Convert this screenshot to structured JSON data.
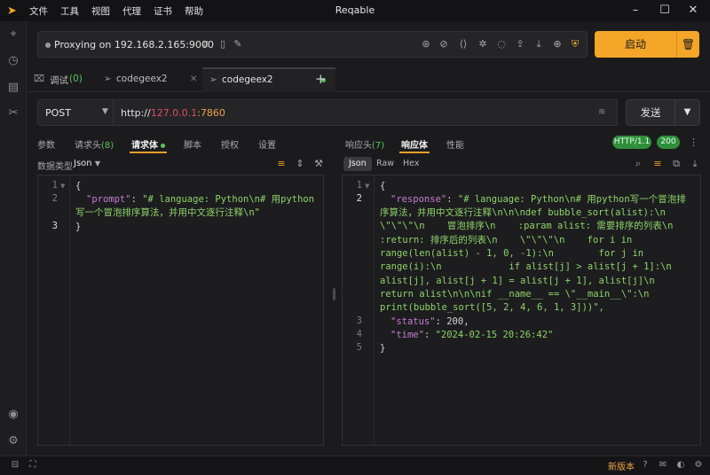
{
  "app": {
    "title": "Reqable"
  },
  "menu": [
    "文件",
    "工具",
    "视图",
    "代理",
    "证书",
    "帮助"
  ],
  "proxy": {
    "status_text": "Proxying on 192.168.2.165:9000",
    "start_label": "启动"
  },
  "tabs": [
    {
      "label": "调试",
      "count": "(0)"
    },
    {
      "label": "codegeex2"
    },
    {
      "label": "codegeex2"
    }
  ],
  "request": {
    "method": "POST",
    "url_scheme": "http://",
    "url_host": "127.0.0.1",
    "url_port": ":7860",
    "send_label": "发送"
  },
  "left_panel": {
    "tabs": {
      "params": "参数",
      "headers": "请求头",
      "headers_count": "(8)",
      "body": "请求体",
      "script": "脚本",
      "auth": "授权",
      "settings": "设置"
    },
    "data_type_label": "数据类型",
    "data_type_value": "Json",
    "lines": [
      "1",
      "2",
      "3"
    ],
    "code": {
      "open": "{",
      "key": "\"prompt\"",
      "colon": ": ",
      "value_l1": "\"# language: Python\\n# 用python",
      "value_l2": "写一个冒泡排序算法，并用中文逐行注释\\n\"",
      "close": "}"
    }
  },
  "right_panel": {
    "tabs": {
      "headers": "响应头",
      "headers_count": "(7)",
      "body": "响应体",
      "perf": "性能"
    },
    "http_version": "HTTP/1.1",
    "status_code": "200",
    "formats": [
      "Json",
      "Raw",
      "Hex"
    ],
    "lines": [
      "1",
      "2",
      "3",
      "4",
      "5"
    ],
    "code": {
      "open": "{",
      "response_key": "\"response\"",
      "response_lines": [
        "\"# language: Python\\n# 用python写一个冒泡排",
        "序算法，并用中文逐行注释\\n\\n\\ndef bubble_sort(alist):\\n",
        "\\\"\\\"\\\"\\n    冒泡排序\\n    :param alist: 需要排序的列表\\n",
        ":return: 排序后的列表\\n    \\\"\\\"\\\"\\n    for i in",
        "range(len(alist) - 1, 0, -1):\\n        for j in",
        "range(i):\\n            if alist[j] > alist[j + 1]:\\n",
        "alist[j], alist[j + 1] = alist[j + 1], alist[j]\\n",
        "return alist\\n\\n\\nif __name__ == \\\"__main__\\\":\\n",
        "print(bubble_sort([5, 2, 4, 6, 1, 3]))\","
      ],
      "status_key": "\"status\"",
      "status_value": "200,",
      "time_key": "\"time\"",
      "time_value": "\"2024-02-15 20:26:42\"",
      "close": "}"
    }
  },
  "statusbar": {
    "new_version": "新版本"
  },
  "colors": {
    "accent": "#f4a629",
    "success": "#2f8f3c",
    "string": "#8fd36a",
    "key": "#c77bd2"
  }
}
